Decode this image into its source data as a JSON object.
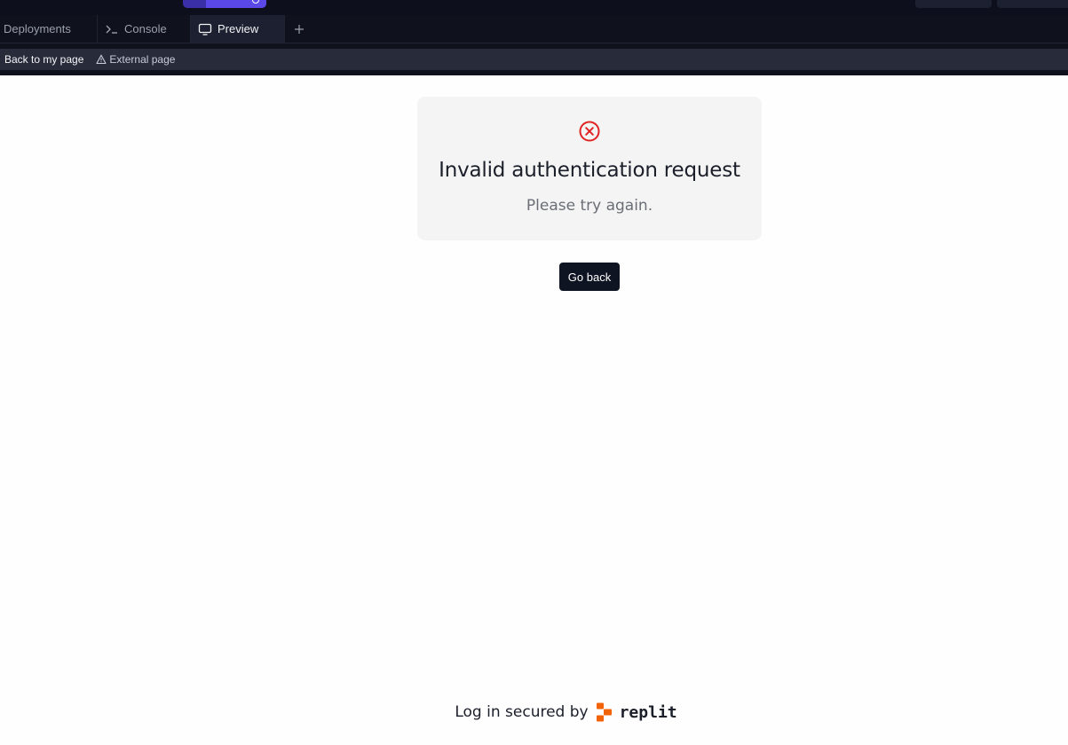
{
  "tabs": [
    {
      "label": "Deployments"
    },
    {
      "label": "Console"
    },
    {
      "label": "Preview"
    }
  ],
  "toolbar": {
    "back_label": "Back to my page",
    "external_label": "External page"
  },
  "error": {
    "title": "Invalid authentication request",
    "message": "Please try again.",
    "icon": "x-circle-icon",
    "icon_color": "#e02424"
  },
  "actions": {
    "go_back_label": "Go back"
  },
  "footer": {
    "secured_text": "Log in secured by",
    "brand": "replit",
    "brand_color": "#f26207"
  }
}
